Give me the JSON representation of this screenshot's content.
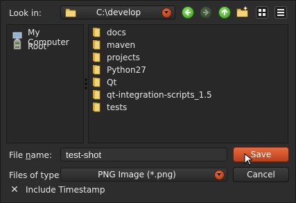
{
  "look_in": {
    "label": "Look in:",
    "path": "C:\\develop"
  },
  "toolbar": {
    "back_icon": "back-arrow-icon",
    "forward_icon": "forward-arrow-icon",
    "up_icon": "parent-folder-icon",
    "new_folder_icon": "new-folder-icon",
    "list_view_icon": "list-view-icon",
    "detail_view_icon": "detail-view-icon"
  },
  "sidebar": {
    "items": [
      {
        "label": "My Computer",
        "icon": "computer-icon"
      },
      {
        "label": "Root",
        "icon": "drive-icon"
      }
    ]
  },
  "files": [
    {
      "name": "docs"
    },
    {
      "name": "maven"
    },
    {
      "name": "projects"
    },
    {
      "name": "Python27"
    },
    {
      "name": "Qt"
    },
    {
      "name": "qt-integration-scripts_1.5"
    },
    {
      "name": "tests"
    }
  ],
  "form": {
    "file_name_label_pre": "File ",
    "file_name_label_underlined": "n",
    "file_name_label_post": "ame:",
    "file_name_value": "test-shot",
    "file_type_label": "Files of type:",
    "file_type_value": "PNG Image (*.png)"
  },
  "buttons": {
    "save": "Save",
    "cancel": "Cancel"
  },
  "options": {
    "include_timestamp_label": "Include Timestamp",
    "include_timestamp_checked": true
  },
  "colors": {
    "accent": "#d9552a",
    "background": "#2d2d2d",
    "folder": "#e8c25a",
    "nav_green": "#5cc23a"
  }
}
